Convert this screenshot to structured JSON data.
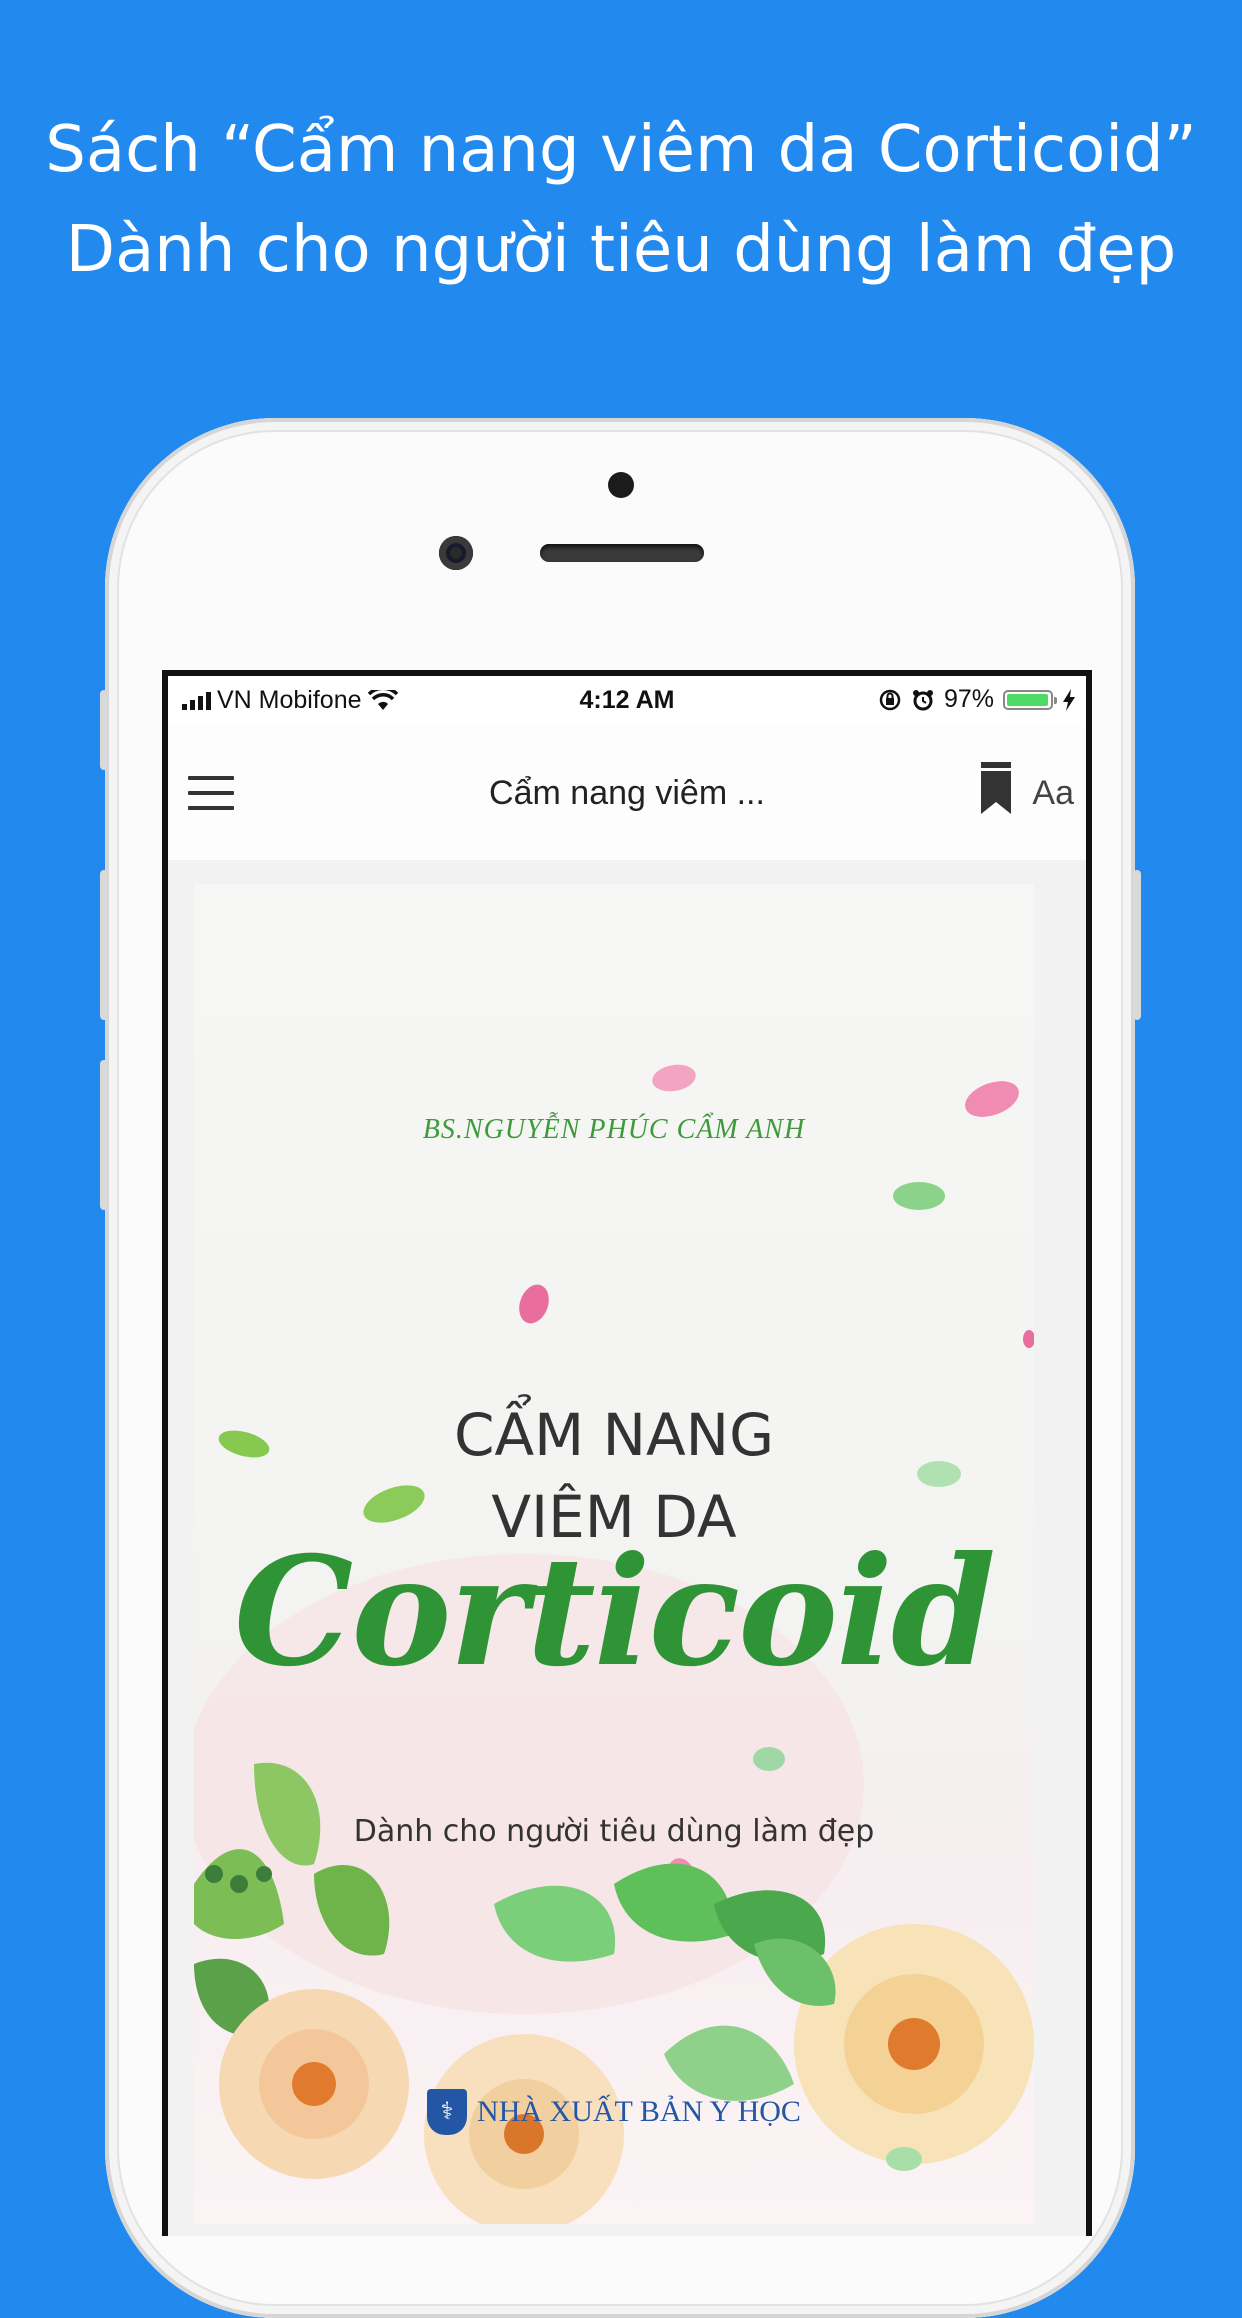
{
  "headline": {
    "line1": "Sách “Cẩm nang viêm da Corticoid”",
    "line2": "Dành cho người tiêu dùng làm đẹp"
  },
  "statusbar": {
    "carrier": "VN Mobifone",
    "time": "4:12 AM",
    "battery": "97%",
    "battery_level": 0.97
  },
  "navbar": {
    "menu_icon": "hamburger-menu-icon",
    "title": "Cẩm nang viêm ...",
    "bookmark_icon": "bookmark-icon",
    "font_label": "Aa"
  },
  "cover": {
    "author": "BS.NGUYỄN PHÚC CẨM ANH",
    "title_line1": "CẨM NANG",
    "title_line2": "VIÊM DA",
    "title_script": "Corticoid",
    "subtitle": "Dành cho người tiêu dùng làm đẹp",
    "publisher": "NHÀ XUẤT BẢN Y HỌC",
    "colors": {
      "green": "#2f9436",
      "petal_pink": "#f08cb1",
      "flower_peach": "#f6cf9a",
      "leaf_green": "#5fbf5a"
    }
  },
  "colors": {
    "background": "#2289ee",
    "battery": "#4cd964"
  }
}
